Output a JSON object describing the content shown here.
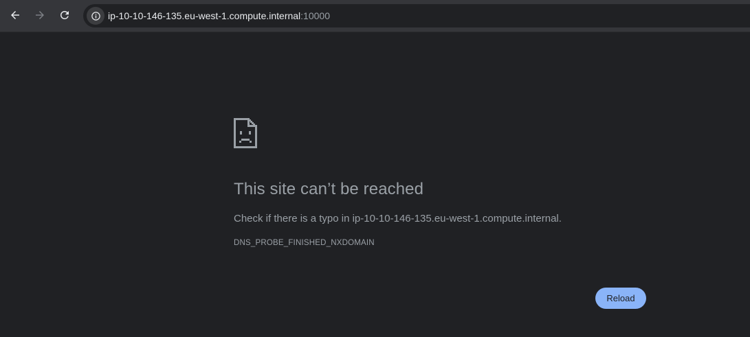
{
  "browser": {
    "url_host": "ip-10-10-146-135.eu-west-1.compute.internal",
    "url_port": ":10000",
    "icons": {
      "back": "back-arrow-icon",
      "forward": "forward-arrow-icon",
      "reload": "reload-icon",
      "site_info": "info-icon"
    }
  },
  "error_page": {
    "icon": "sad-page-icon",
    "title": "This site can’t be reached",
    "description": "Check if there is a typo in ip-10-10-146-135.eu-west-1.compute.internal.",
    "error_code": "DNS_PROBE_FINISHED_NXDOMAIN",
    "reload_label": "Reload"
  },
  "colors": {
    "background": "#202124",
    "toolbar": "#35363a",
    "text_muted": "#9aa0a6",
    "accent": "#8ab4f8"
  }
}
